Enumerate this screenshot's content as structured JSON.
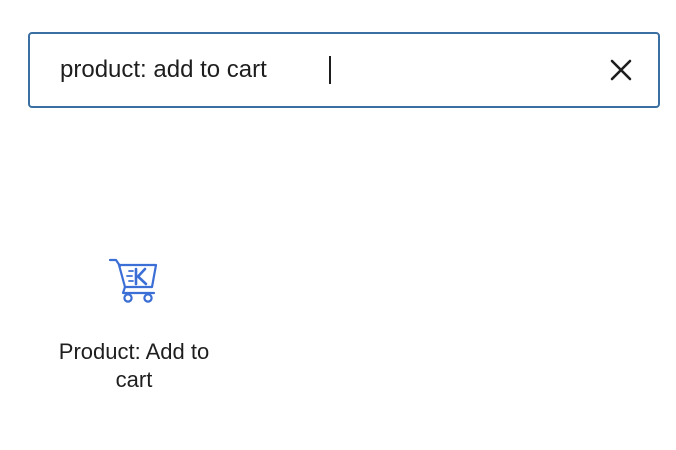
{
  "search": {
    "value": "product: add to cart",
    "clear_icon": "close-icon"
  },
  "results": [
    {
      "label": "Product: Add to cart",
      "icon": "shopping-cart-icon",
      "icon_color": "#3b6fd6"
    }
  ],
  "colors": {
    "accent": "#3a6fa3",
    "text": "#1e1e1e"
  }
}
